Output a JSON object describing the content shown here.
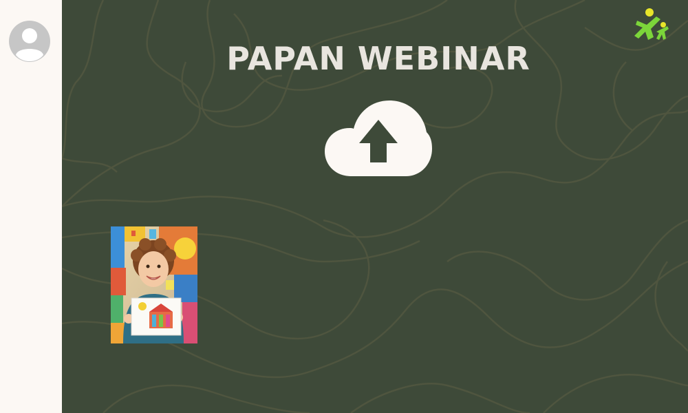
{
  "header": {
    "title": "PAPAN WEBINAR"
  },
  "sidebar": {
    "avatar_icon": "user-avatar-icon"
  },
  "upload": {
    "icon": "cloud-upload-icon"
  },
  "brand": {
    "logo_icon": "kids-brand-logo"
  },
  "photo": {
    "description_icon": "child-holding-drawing-photo"
  },
  "colors": {
    "background": "#3e4a39",
    "sidebar": "#fcf8f4",
    "title": "#e9e5df",
    "upload_icon": "#fcf8f4",
    "topo_lines": "#4f553f",
    "logo_green": "#7cd63a",
    "logo_yellow": "#e8e52a"
  }
}
